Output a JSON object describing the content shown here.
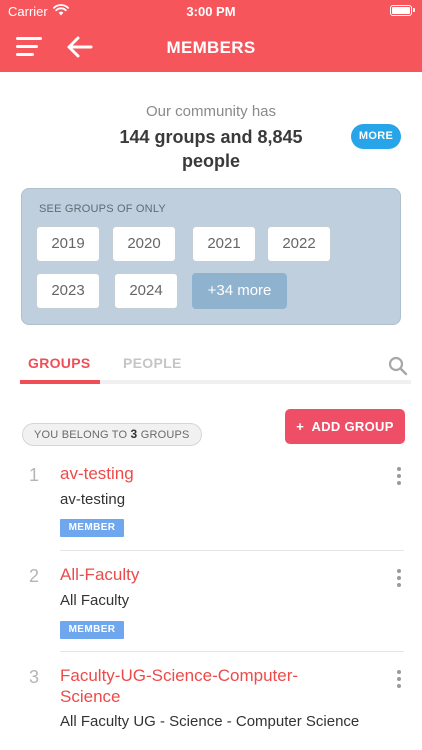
{
  "status_bar": {
    "carrier": "Carrier",
    "time": "3:00 PM"
  },
  "header": {
    "title": "MEMBERS",
    "menu_icon": "hamburger-menu-icon",
    "back_icon": "back-arrow-icon"
  },
  "community": {
    "label": "Our community has",
    "stats": "144 groups and 8,845 people",
    "more_label": "MORE"
  },
  "year_filter": {
    "label": "SEE GROUPS OF ONLY",
    "years": [
      "2019",
      "2020",
      "2021",
      "2022",
      "2023",
      "2024"
    ],
    "more_label": "+34 more"
  },
  "tabs": [
    {
      "label": "GROUPS",
      "active": true
    },
    {
      "label": "PEOPLE",
      "active": false
    }
  ],
  "membership": {
    "prefix": "YOU BELONG TO",
    "count": "3",
    "suffix": "GROUPS"
  },
  "add_group": {
    "plus": "+",
    "label": "ADD GROUP"
  },
  "groups": [
    {
      "index": "1",
      "name": "av-testing",
      "description": "av-testing",
      "badge": "MEMBER"
    },
    {
      "index": "2",
      "name": "All-Faculty",
      "description": "All Faculty",
      "badge": "MEMBER"
    },
    {
      "index": "3",
      "name": "Faculty-UG-Science-Computer-Science",
      "description": "All Faculty UG - Science - Computer Science",
      "badge": ""
    }
  ],
  "colors": {
    "header": "#f5555b",
    "accent": "#f04e57",
    "more": "#27a5e8",
    "member_badge": "#6ea7ee"
  }
}
